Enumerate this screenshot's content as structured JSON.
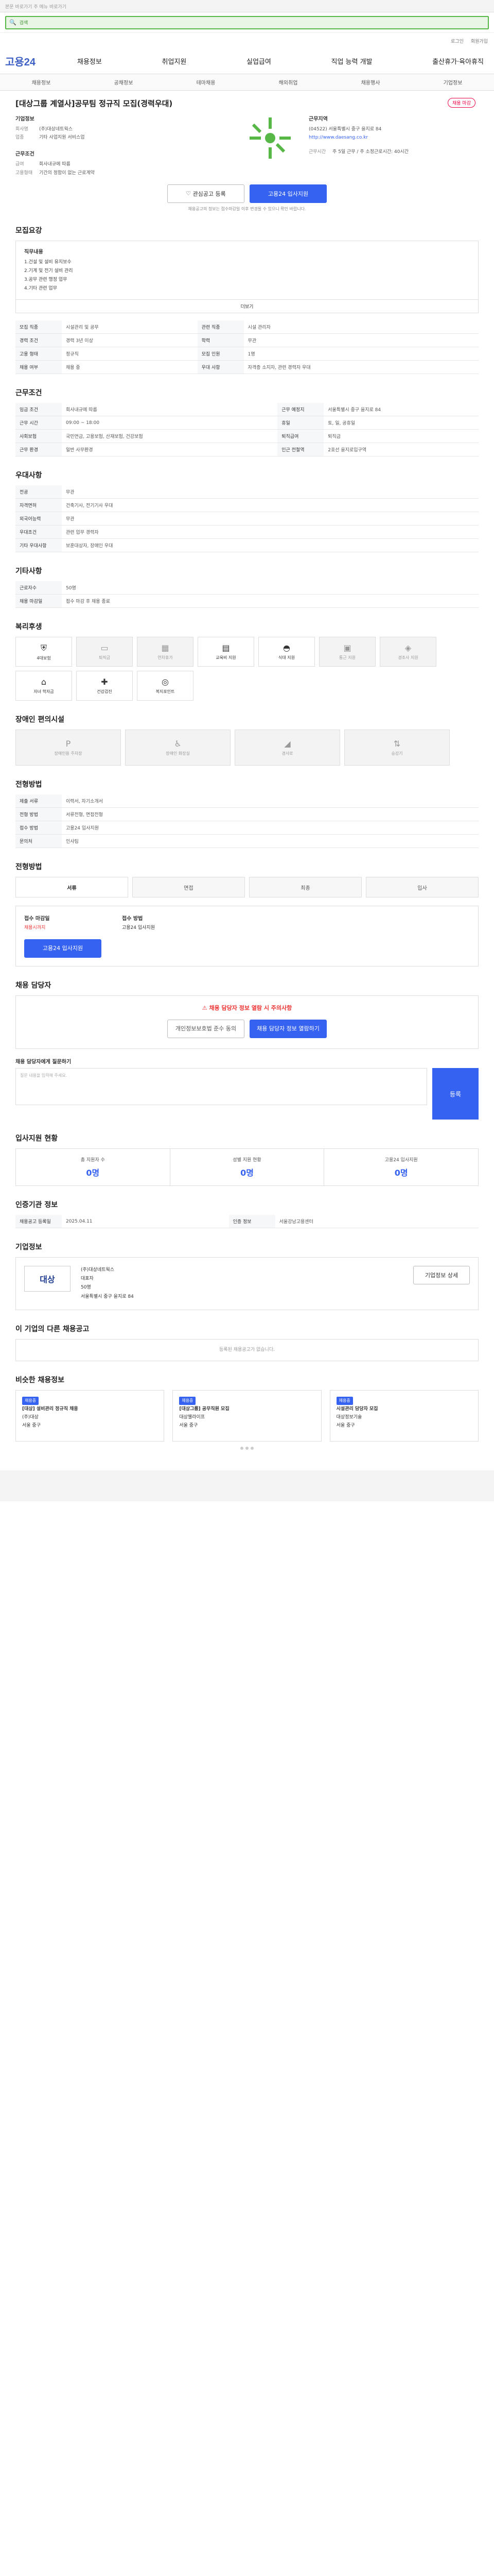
{
  "skip": "본문 바로가기 주 메뉴 바로가기",
  "search": {
    "label": "검색"
  },
  "util": [
    "로그인",
    "회원가입"
  ],
  "logo": "고용24",
  "gnb": [
    "채용정보",
    "취업지원",
    "실업급여",
    "직업 능력 개발",
    "출산휴가·육아휴직"
  ],
  "sub": [
    "채용정보",
    "공채정보",
    "테마채용",
    "해외취업",
    "채용행사",
    "기업정보"
  ],
  "job": {
    "title": "[대상그룹 계열사]공무팀 정규직 모집(경력우대)",
    "tag": "채용 마감",
    "l1_label": "기업정보",
    "company_k": "회사명",
    "company": "(주)대상네트웍스",
    "biz_k": "업종",
    "biz": "기타 사업지원 서비스업",
    "cond_label": "근무조건",
    "pay_k": "급여",
    "pay": "회사내규에 따름",
    "type_k": "고용형태",
    "type": "기간의 정함이 없는 근로계약",
    "place_label": "근무지역",
    "place": "(04522) 서울특별시 중구 을지로 84",
    "site": "http://www.daesang.co.kr",
    "time_k": "근무시간",
    "time": "주 5일 근무 / 주 소정근로시간: 40시간"
  },
  "btns": {
    "save": "관심공고 등록",
    "apply": "고용24 입사지원"
  },
  "notice": "채용공고의 정보는 접수마감일 이후 변경될 수 있으니 확인 바랍니다.",
  "s1": {
    "h": "모집요강",
    "box_title": "직무내용",
    "lines": [
      "1.건설 및 설비 유지보수",
      "2.기계 및 전기 설비 관리",
      "3.공무 관련 행정 업무",
      "4.기타 관련 업무"
    ],
    "more": "더보기"
  },
  "t1": [
    [
      "모집 직종",
      "시설관리 및 공무",
      "관련 직종",
      "시설 관리자"
    ],
    [
      "경력 조건",
      "경력 3년 이상",
      "학력",
      "무관"
    ],
    [
      "고용 형태",
      "정규직",
      "모집 인원",
      "1명"
    ],
    [
      "채용 여부",
      "채용 중",
      "우대 사항",
      "자격증 소지자, 관련 경력자 우대"
    ]
  ],
  "s2": {
    "h": "근무조건"
  },
  "t2": [
    [
      "임금 조건",
      "회사내규에 따름",
      "근무 예정지",
      "서울특별시 중구 을지로 84"
    ],
    [
      "근무 시간",
      "09:00 ~ 18:00",
      "휴일",
      "토, 일, 공휴일"
    ],
    [
      "사회보험",
      "국민연금, 고용보험, 산재보험, 건강보험",
      "퇴직급여",
      "퇴직금"
    ],
    [
      "근무 환경",
      "일반 사무환경",
      "인근 전철역",
      "2호선 을지로입구역"
    ]
  ],
  "s3": {
    "h": "우대사항"
  },
  "t3": [
    [
      "전공",
      "무관"
    ],
    [
      "자격면허",
      "건축기사, 전기기사 우대"
    ],
    [
      "외국어능력",
      "무관"
    ],
    [
      "우대조건",
      "관련 업무 경력자"
    ],
    [
      "기타 우대사항",
      "보훈대상자, 장애인 우대"
    ]
  ],
  "s4": {
    "h": "기타사항"
  },
  "t4": [
    [
      "근로자수",
      "50명"
    ],
    [
      "채용 마감일",
      "접수 마감 후 채용 종료"
    ]
  ],
  "s5": {
    "h": "복리후생"
  },
  "wel": [
    "4대보험",
    "퇴직금",
    "연차휴가",
    "교육비 지원",
    "식대 지원",
    "통근 지원",
    "경조사 지원",
    "자녀 학자금",
    "건강검진",
    "복지포인트"
  ],
  "s6": {
    "h": "장애인 편의시설"
  },
  "dis": [
    "장애인용 주차장",
    "장애인 화장실",
    "경사로",
    "승강기"
  ],
  "s7": {
    "h": "전형방법"
  },
  "t7": [
    [
      "제출 서류",
      "이력서, 자기소개서"
    ],
    [
      "전형 방법",
      "서류전형, 면접전형"
    ],
    [
      "접수 방법",
      "고용24 입사지원"
    ],
    [
      "문의처",
      "인사팀"
    ]
  ],
  "s8": {
    "h": "전형방법",
    "steps": [
      "서류",
      "면접",
      "최종",
      "입사"
    ]
  },
  "sum": {
    "a1": "접수 마감일",
    "a2": "채용시까지",
    "b1": "접수 방법",
    "b2": "고용24 입사지원",
    "apply": "고용24 입사지원"
  },
  "s9": {
    "h": "채용 담당자",
    "warn": "채용 담당자 정보 열람 시 주의사항",
    "btn1": "개인정보보호법 준수 동의",
    "btn2": "채용 담당자 정보 열람하기"
  },
  "qa": {
    "h": "채용 담당자에게 질문하기",
    "ph": "질문 내용을 입력해 주세요.",
    "btn": "등록"
  },
  "s10": {
    "h": "입사지원 현황",
    "c1": "총 지원자 수",
    "v1": "0명",
    "c2": "성별 지원 현황",
    "v2": "0명",
    "c3": "고용24 입사지원",
    "v3": "0명"
  },
  "s11": {
    "h": "인증기관 정보"
  },
  "t11": [
    [
      "채용공고 등록일",
      "2025.04.11",
      "인증 정보",
      "서울강남고용센터"
    ]
  ],
  "s12": {
    "h": "기업정보",
    "logo": "대상",
    "c_name": "(주)대상네트웍스",
    "c_rep": "대표자",
    "c_emp": "50명",
    "c_addr": "서울특별시 중구 을지로 84",
    "c_btn": "기업정보 상세"
  },
  "s13": {
    "h": "이 기업의 다른 채용공고",
    "empty": "등록된 채용공고가 없습니다."
  },
  "s14": {
    "h": "비슷한 채용정보",
    "cards": [
      {
        "badge": "채용중",
        "title": "[대상] 설비관리 정규직 채용",
        "co": "(주)대상",
        "loc": "서울 중구"
      },
      {
        "badge": "채용중",
        "title": "[대상그룹] 공무직원 모집",
        "co": "대상웰라이프",
        "loc": "서울 중구"
      },
      {
        "badge": "채용중",
        "title": "시설관리 담당자 모집",
        "co": "대상정보기술",
        "loc": "서울 중구"
      }
    ]
  }
}
